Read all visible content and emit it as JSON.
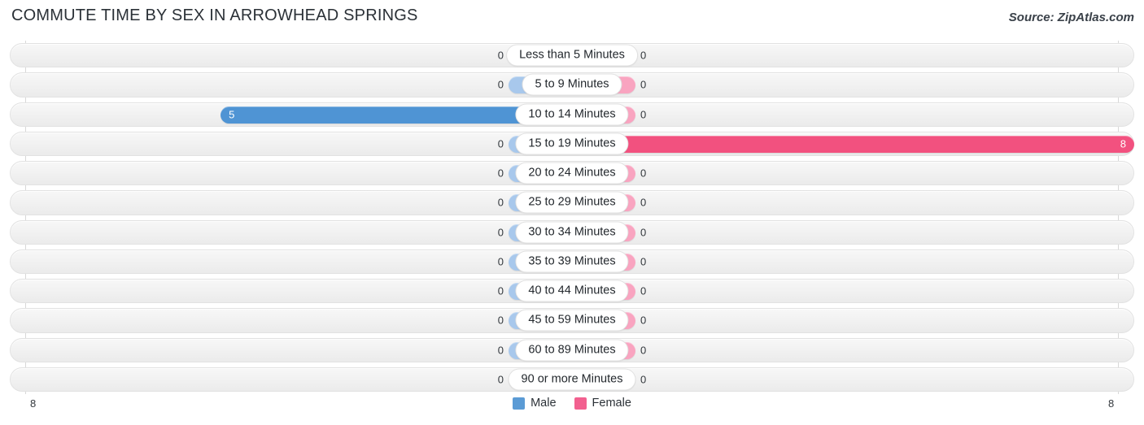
{
  "header": {
    "title": "COMMUTE TIME BY SEX IN ARROWHEAD SPRINGS",
    "source": "Source: ZipAtlas.com"
  },
  "legend": {
    "male_label": "Male",
    "female_label": "Female",
    "male_color": "#5b9bd5",
    "female_color": "#f2608f"
  },
  "axis": {
    "left_label": "8",
    "right_label": "8"
  },
  "colors": {
    "male_zero": "#a8c8ec",
    "male_value": "#4f94d4",
    "female_zero": "#f9a4c0",
    "female_value": "#f2517f",
    "track": "#f2f2f2",
    "pill_bg": "#ffffff"
  },
  "chart_data": {
    "type": "bar",
    "orientation": "horizontal-diverging",
    "title": "COMMUTE TIME BY SEX IN ARROWHEAD SPRINGS",
    "xlabel": "",
    "ylabel": "",
    "xlim": [
      8,
      8
    ],
    "grid": false,
    "legend_position": "bottom-center",
    "categories": [
      "Less than 5 Minutes",
      "5 to 9 Minutes",
      "10 to 14 Minutes",
      "15 to 19 Minutes",
      "20 to 24 Minutes",
      "25 to 29 Minutes",
      "30 to 34 Minutes",
      "35 to 39 Minutes",
      "40 to 44 Minutes",
      "45 to 59 Minutes",
      "60 to 89 Minutes",
      "90 or more Minutes"
    ],
    "series": [
      {
        "name": "Male",
        "values": [
          0,
          0,
          5,
          0,
          0,
          0,
          0,
          0,
          0,
          0,
          0,
          0
        ]
      },
      {
        "name": "Female",
        "values": [
          0,
          0,
          0,
          8,
          0,
          0,
          0,
          0,
          0,
          0,
          0,
          0
        ]
      }
    ]
  },
  "rows": [
    {
      "label": "Less than 5 Minutes",
      "male": "0",
      "female": "0"
    },
    {
      "label": "5 to 9 Minutes",
      "male": "0",
      "female": "0"
    },
    {
      "label": "10 to 14 Minutes",
      "male": "5",
      "female": "0"
    },
    {
      "label": "15 to 19 Minutes",
      "male": "0",
      "female": "8"
    },
    {
      "label": "20 to 24 Minutes",
      "male": "0",
      "female": "0"
    },
    {
      "label": "25 to 29 Minutes",
      "male": "0",
      "female": "0"
    },
    {
      "label": "30 to 34 Minutes",
      "male": "0",
      "female": "0"
    },
    {
      "label": "35 to 39 Minutes",
      "male": "0",
      "female": "0"
    },
    {
      "label": "40 to 44 Minutes",
      "male": "0",
      "female": "0"
    },
    {
      "label": "45 to 59 Minutes",
      "male": "0",
      "female": "0"
    },
    {
      "label": "60 to 89 Minutes",
      "male": "0",
      "female": "0"
    },
    {
      "label": "90 or more Minutes",
      "male": "0",
      "female": "0"
    }
  ]
}
